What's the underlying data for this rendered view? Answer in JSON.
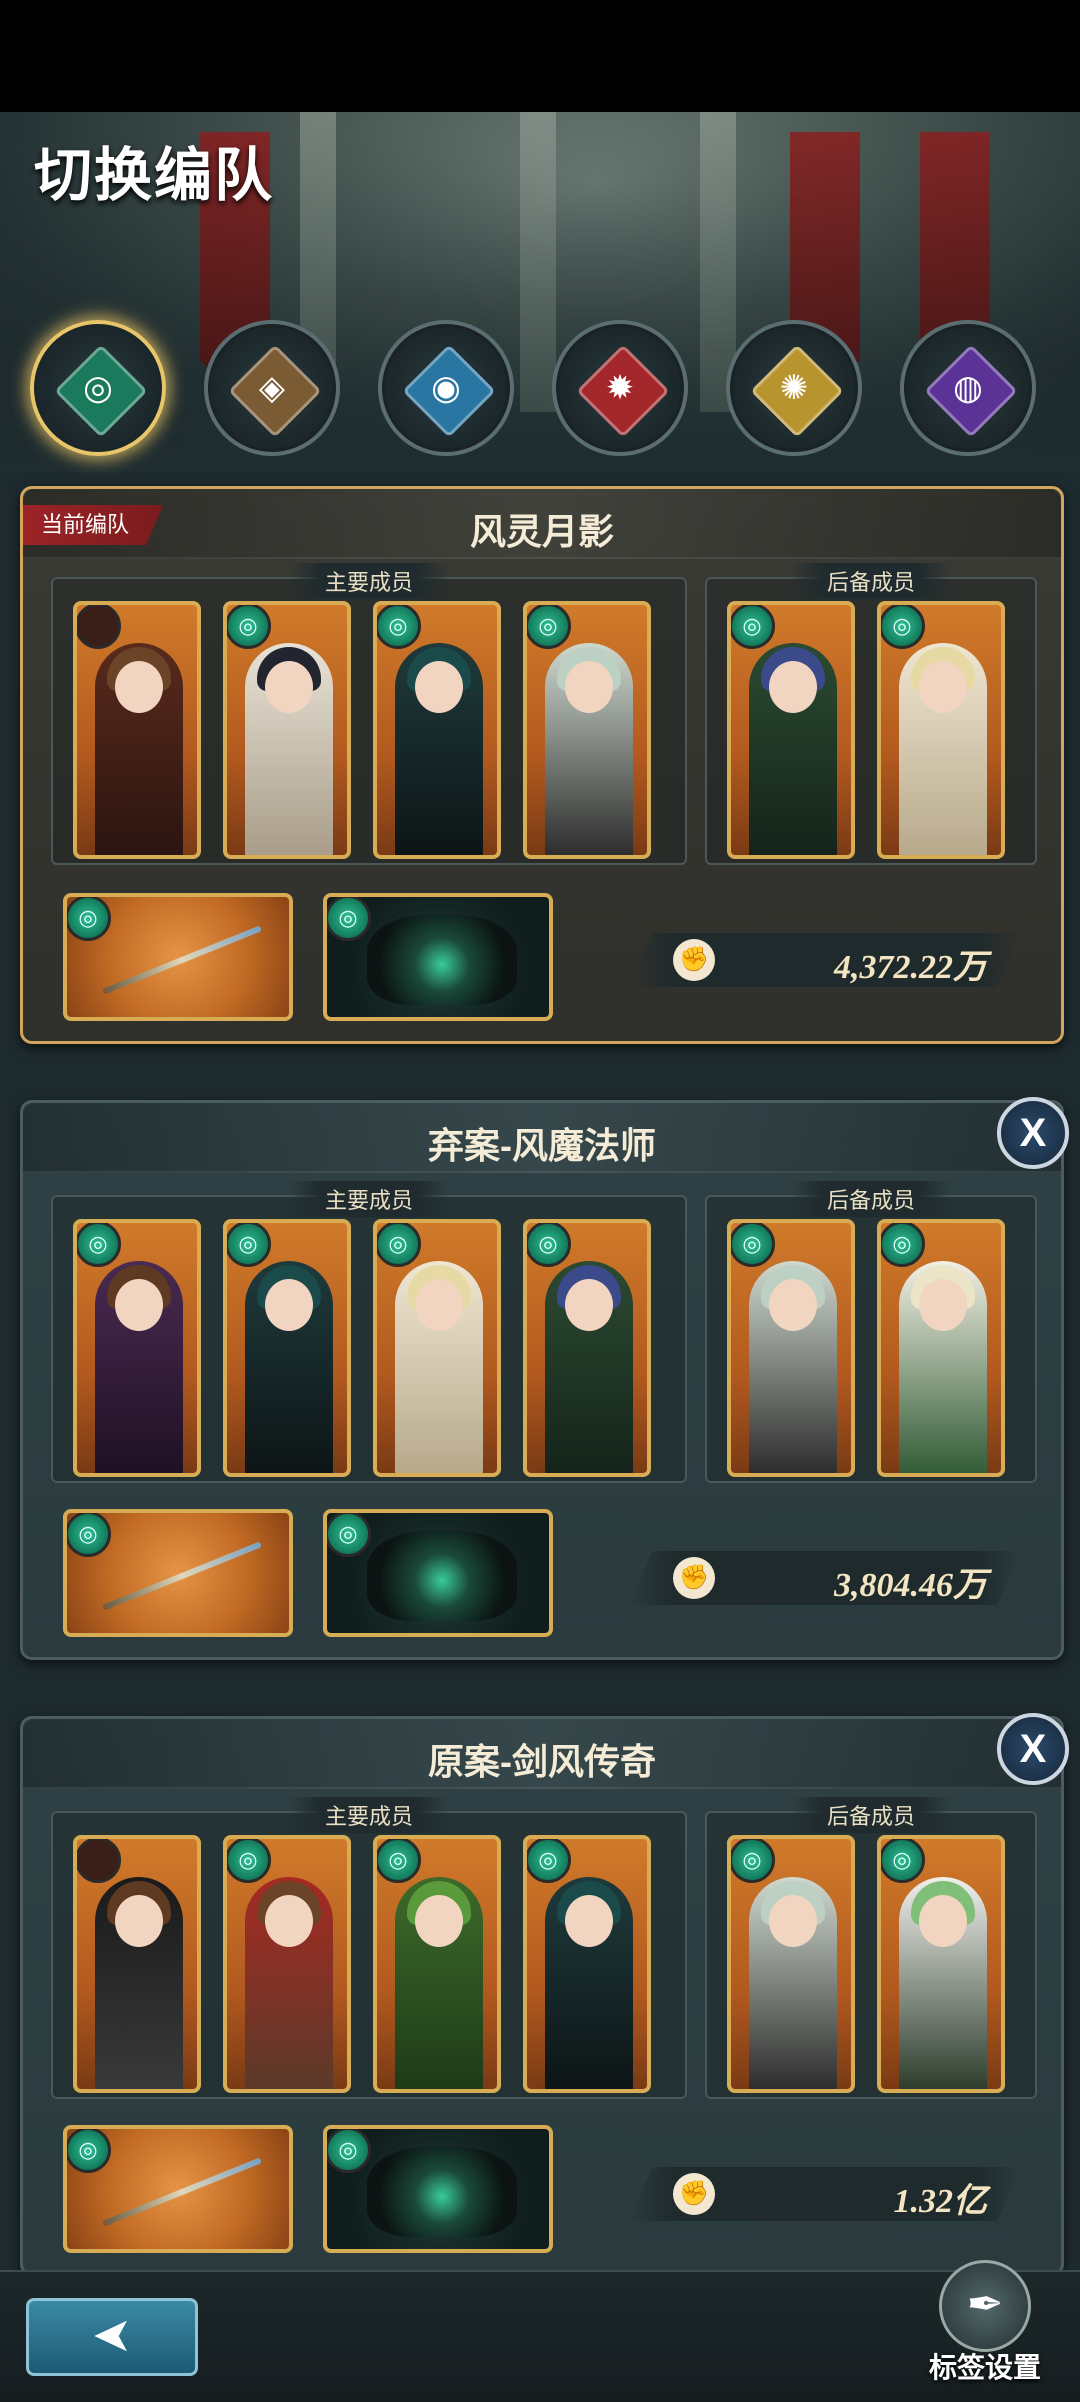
{
  "header": {
    "title": "切换编队"
  },
  "elements": [
    {
      "icon": "wind-element-icon",
      "glyph": "◎",
      "color": "#2fbf92",
      "selected": true
    },
    {
      "icon": "earth-element-icon",
      "glyph": "◈",
      "color": "#b38c5a",
      "selected": false
    },
    {
      "icon": "water-element-icon",
      "glyph": "◉",
      "color": "#3fa3d8",
      "selected": false
    },
    {
      "icon": "fire-element-icon",
      "glyph": "✹",
      "color": "#c8393b",
      "selected": false
    },
    {
      "icon": "light-element-icon",
      "glyph": "✺",
      "color": "#d6b44b",
      "selected": false
    },
    {
      "icon": "dark-element-icon",
      "glyph": "◍",
      "color": "#7a4bc2",
      "selected": false
    }
  ],
  "labels": {
    "main_members": "主要成员",
    "backup_members": "后备成员",
    "current_team": "当前编队"
  },
  "teams": [
    {
      "name": "风灵月影",
      "current": true,
      "power": "4,372.22万",
      "closable": false
    },
    {
      "name": "弃案-风魔法师",
      "current": false,
      "power": "3,804.46万",
      "closable": true
    },
    {
      "name": "原案-剑风传奇",
      "current": false,
      "power": "1.32亿",
      "closable": true
    }
  ],
  "close_label": "X",
  "footer": {
    "tag_settings": "标签设置",
    "back_icon": "back-arrow-icon"
  }
}
